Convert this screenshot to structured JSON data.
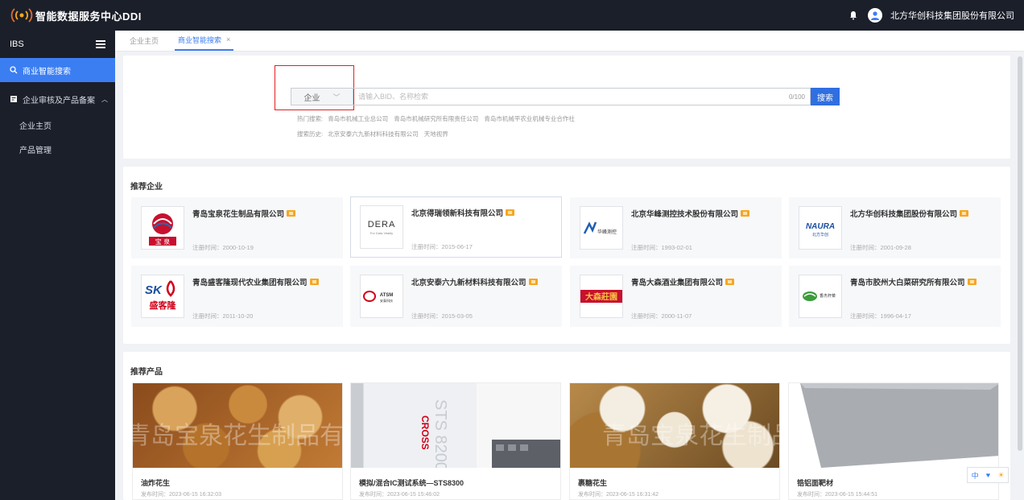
{
  "app": {
    "title": "智能数据服务中心DDI",
    "user_company": "北方华创科技集团股份有限公司"
  },
  "sidebar": {
    "header": "IBS",
    "active_item": "商业智能搜索",
    "group": "企业审核及产品备案",
    "sub_items": [
      "企业主页",
      "产品管理"
    ]
  },
  "tabs": [
    {
      "label": "企业主页"
    },
    {
      "label": "商业智能搜索",
      "close": "×"
    }
  ],
  "search": {
    "type_value": "企业",
    "placeholder": "请输入BID、名称检索",
    "counter": "0/100",
    "button": "搜索",
    "hot_label": "热门搜索:",
    "hot": [
      "青岛市机械工业总公司",
      "青岛市机械研究所有限责任公司",
      "青岛市机械平农业机械专业合作社"
    ],
    "history_label": "搜索历史:",
    "history": [
      "北京安泰六九新材料科技有限公司",
      "天地视界"
    ]
  },
  "recommended_enterprises": {
    "title": "推荐企业",
    "items": [
      {
        "name": "青岛宝泉花生制品有限公司",
        "date": "注册时间：2000-10-19",
        "logo_text": "宝 泉"
      },
      {
        "name": "北京得瑞领新科技有限公司",
        "date": "注册时间：2015-06-17",
        "logo_text": "DERA",
        "logo_sub": "For Data Vitality"
      },
      {
        "name": "北京华峰测控技术股份有限公司",
        "date": "注册时间：1993-02-01",
        "logo_text": "华峰测控"
      },
      {
        "name": "北方华创科技集团股份有限公司",
        "date": "注册时间：2001-09-28",
        "logo_text": "NAURA",
        "logo_sub": "北方华创"
      },
      {
        "name": "青岛盛客隆现代农业集团有限公司",
        "date": "注册时间：2011-10-20",
        "logo_text": "SK",
        "logo_sub": "盛客隆"
      },
      {
        "name": "北京安泰六九新材料科技有限公司",
        "date": "注册时间：2015-03-05",
        "logo_text": "ATSM",
        "logo_sub": "安泰科技"
      },
      {
        "name": "青岛大森酒业集团有限公司",
        "date": "注册时间：2000-11-07",
        "logo_text": "大森莊園"
      },
      {
        "name": "青岛市胶州大白菜研究所有限公司",
        "date": "注册时间：1996-04-17",
        "logo_text": "香杰杆菜"
      }
    ]
  },
  "recommended_products": {
    "title": "推荐产品",
    "items": [
      {
        "name": "油炸花生",
        "date": "发布时间：2023-06-15 16:32:03",
        "watermark": "青岛宝泉花生制品有限公"
      },
      {
        "name": "模拟/混合IC测试系统—STS8300",
        "date": "发布时间：2023-06-15 15:46:02",
        "img_text": "STS 8200",
        "img_text2": "CROSS"
      },
      {
        "name": "裹糖花生",
        "date": "发布时间：2023-06-15 16:31:42",
        "watermark": "青岛宝泉花生制品"
      },
      {
        "name": "锆铝面靶材",
        "date": "发布时间：2023-06-15 15:44:51"
      }
    ]
  },
  "float_tools": [
    "中",
    "♥",
    "☀"
  ],
  "colors": {
    "accent": "#3b7ef2",
    "dark": "#1b1f2a",
    "highlight_box": "#e02020",
    "badge": "#f5a623"
  }
}
